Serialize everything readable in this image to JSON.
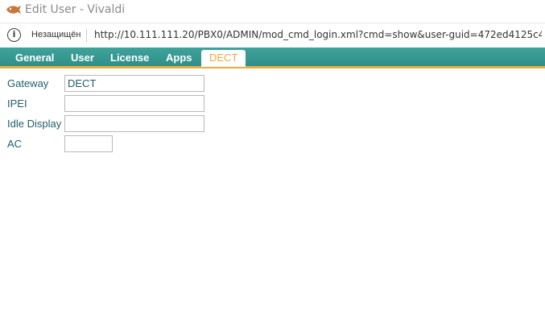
{
  "window": {
    "title": "Edit User - Vivaldi"
  },
  "addressbar": {
    "security_label": "Незащищён",
    "url": "http://10.111.111.20/PBX0/ADMIN/mod_cmd_login.xml?cmd=show&user-guid=472ed4125c48..."
  },
  "tabs": [
    {
      "label": "General"
    },
    {
      "label": "User"
    },
    {
      "label": "License"
    },
    {
      "label": "Apps"
    },
    {
      "label": "DECT",
      "active": true
    }
  ],
  "form": {
    "gateway": {
      "label": "Gateway",
      "value": "DECT"
    },
    "ipei": {
      "label": "IPEI",
      "value": ""
    },
    "idle_display": {
      "label": "Idle Display",
      "value": ""
    },
    "ac": {
      "label": "AC",
      "value": ""
    }
  },
  "colors": {
    "tab_bar": "#3fa39b",
    "accent_orange": "#f0a93a",
    "label_text": "#1d5f6a"
  }
}
